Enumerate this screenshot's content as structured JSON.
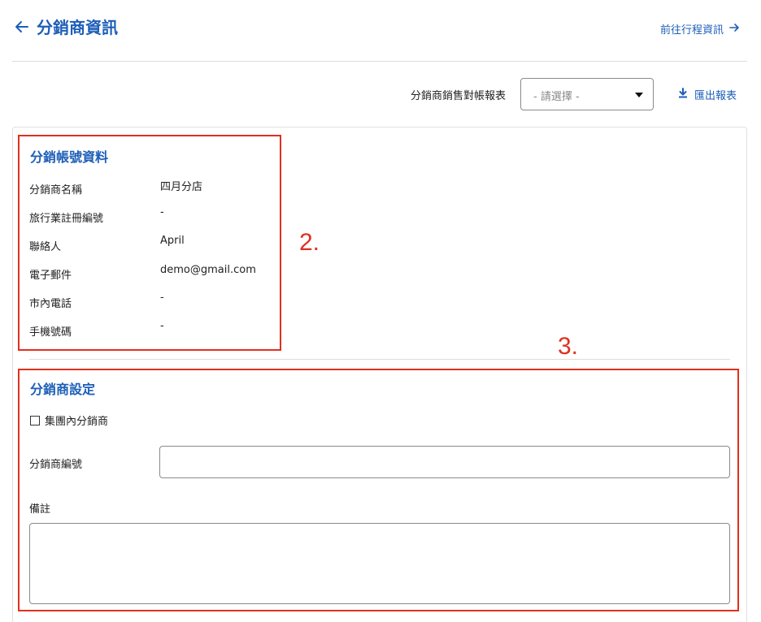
{
  "header": {
    "title": "分銷商資訊",
    "next_link": "前往行程資訊"
  },
  "report": {
    "label": "分銷商銷售對帳報表",
    "select_placeholder": "- 請選擇 -",
    "export_label": "匯出報表"
  },
  "account": {
    "title": "分銷帳號資料",
    "rows": [
      {
        "label": "分銷商名稱",
        "value": "四月分店"
      },
      {
        "label": "旅行業註冊編號",
        "value": "-"
      },
      {
        "label": "聯絡人",
        "value": "April"
      },
      {
        "label": "電子郵件",
        "value": "demo@gmail.com"
      },
      {
        "label": "市內電話",
        "value": "-"
      },
      {
        "label": "手機號碼",
        "value": "-"
      }
    ]
  },
  "settings": {
    "title": "分銷商設定",
    "group_checkbox_label": "集團內分銷商",
    "group_checkbox_checked": false,
    "code_label": "分銷商編號",
    "code_value": "",
    "remark_label": "備註",
    "remark_value": ""
  },
  "annotations": {
    "box2_number": "2.",
    "box3_number": "3.",
    "color": "#e0301e"
  },
  "colors": {
    "accent": "#1d5fb8"
  },
  "icons": {
    "back": "arrow-left-icon",
    "next": "arrow-right-icon",
    "export": "download-icon",
    "select": "caret-down-icon",
    "checkbox": "checkbox-empty-icon"
  }
}
